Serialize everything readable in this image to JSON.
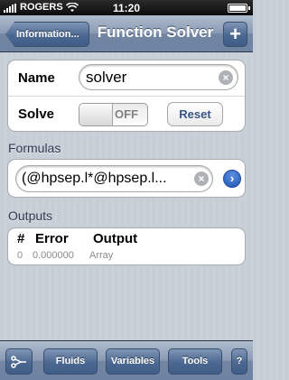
{
  "status_bar": {
    "carrier": "ROGERS",
    "time": "11:20"
  },
  "nav": {
    "back_label": "Information...",
    "title": "Function Solver",
    "add_label": "+"
  },
  "form": {
    "name_label": "Name",
    "name_value": "solver",
    "solve_label": "Solve",
    "solve_switch": "OFF",
    "reset_label": "Reset"
  },
  "formulas": {
    "header": "Formulas",
    "value": "(@hpsep.l*@hpsep.l..."
  },
  "outputs": {
    "header": "Outputs",
    "columns": [
      "#",
      "Error",
      "Output"
    ],
    "rows": [
      {
        "index": "0",
        "error": "0.000000",
        "output": "Array"
      }
    ]
  },
  "toolbar": {
    "fluids_label": "Fluids",
    "variables_label": "Variables",
    "tools_label": "Tools",
    "help_label": "?"
  },
  "colors": {
    "nav_blue": "#6d83a1",
    "button_text": "#3a5583",
    "disclosure": "#2056b4"
  }
}
